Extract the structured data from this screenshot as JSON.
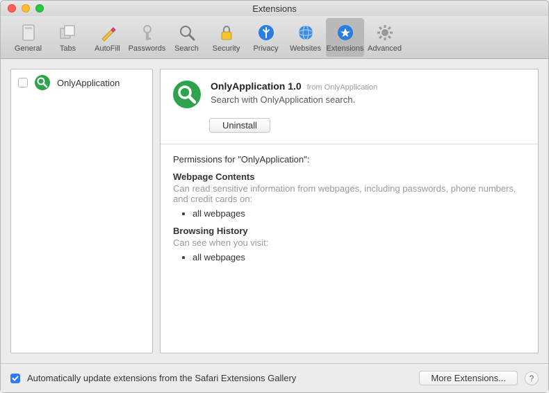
{
  "window": {
    "title": "Extensions"
  },
  "toolbar": {
    "items": [
      {
        "label": "General"
      },
      {
        "label": "Tabs"
      },
      {
        "label": "AutoFill"
      },
      {
        "label": "Passwords"
      },
      {
        "label": "Search"
      },
      {
        "label": "Security"
      },
      {
        "label": "Privacy"
      },
      {
        "label": "Websites"
      },
      {
        "label": "Extensions"
      },
      {
        "label": "Advanced"
      }
    ]
  },
  "sidebar": {
    "items": [
      {
        "name": "OnlyApplication",
        "enabled": false
      }
    ]
  },
  "detail": {
    "title": "OnlyApplication 1.0",
    "from_prefix": "from",
    "from_name": "OnlyApplication",
    "description": "Search with OnlyApplication search.",
    "uninstall_label": "Uninstall",
    "permissions_title": "Permissions for \"OnlyApplication\":",
    "perm1_heading": "Webpage Contents",
    "perm1_desc": "Can read sensitive information from webpages, including passwords, phone numbers, and credit cards on:",
    "perm1_items": [
      "all webpages"
    ],
    "perm2_heading": "Browsing History",
    "perm2_desc": "Can see when you visit:",
    "perm2_items": [
      "all webpages"
    ]
  },
  "footer": {
    "auto_update_label": "Automatically update extensions from the Safari Extensions Gallery",
    "auto_update_checked": true,
    "more_label": "More Extensions...",
    "help_glyph": "?"
  },
  "icons": {
    "ext_color": "#2fa24e"
  }
}
